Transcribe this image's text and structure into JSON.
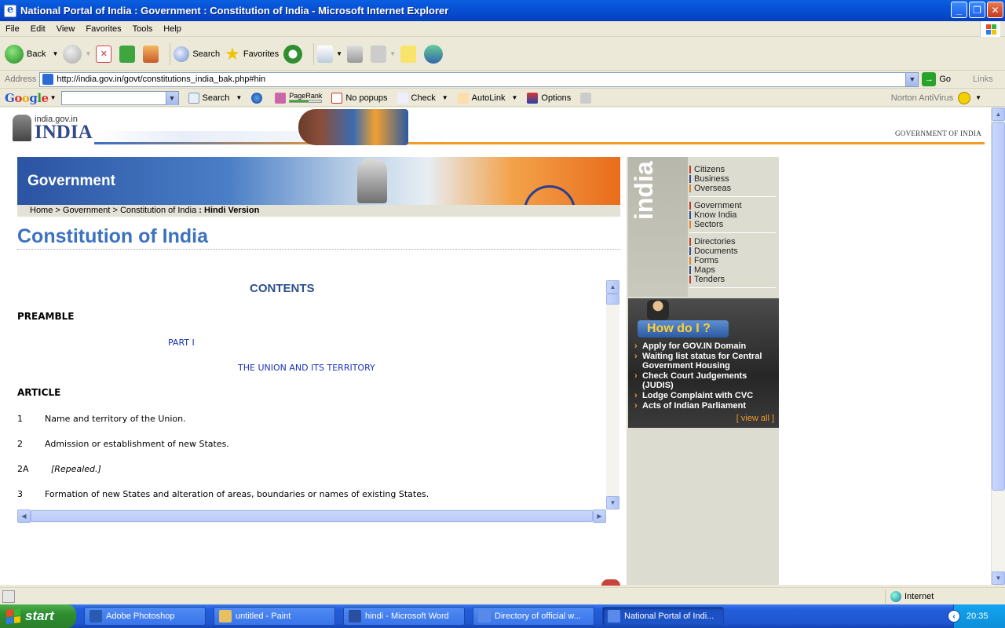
{
  "window": {
    "title": "National Portal of India : Government : Constitution of India - Microsoft Internet Explorer"
  },
  "menu": [
    "File",
    "Edit",
    "View",
    "Favorites",
    "Tools",
    "Help"
  ],
  "toolbar": {
    "back": "Back",
    "search": "Search",
    "favorites": "Favorites"
  },
  "address": {
    "label": "Address",
    "url": "http://india.gov.in/govt/constitutions_india_bak.php#hin",
    "go": "Go",
    "links": "Links"
  },
  "googlebar": {
    "brand": "Google",
    "search": "Search",
    "pagerank": "PageRank",
    "popups": "No popups",
    "check": "Check",
    "autolink": "AutoLink",
    "options": "Options",
    "norton": "Norton AntiVirus"
  },
  "site": {
    "domain": "india.gov.in",
    "logo_word": "INDIA",
    "gov_label": "GOVERNMENT OF INDIA",
    "banner": "Government",
    "breadcrumb": {
      "home": "Home",
      "government": "Government",
      "constitution": "Constitution of India",
      "hindi": "Hindi Version"
    },
    "page_title": "Constitution of India"
  },
  "document": {
    "contents": "CONTENTS",
    "preamble": "PREAMBLE",
    "part": "PART I",
    "part_title": "THE UNION AND ITS TERRITORY",
    "article": "ARTICLE",
    "rows": [
      {
        "num": "1",
        "text": "Name and territory of the Union."
      },
      {
        "num": "2",
        "text": "Admission or establishment of new States."
      },
      {
        "num": "2A",
        "text": "[Repealed.]"
      },
      {
        "num": "3",
        "text": "Formation of new States and alteration of areas, boundaries or names of existing States."
      }
    ]
  },
  "sidebar": {
    "word": "india",
    "groups": [
      [
        {
          "label": "Citizens",
          "color": "#c0392b"
        },
        {
          "label": "Business",
          "color": "#2c4f8f"
        },
        {
          "label": "Overseas",
          "color": "#e67e22"
        }
      ],
      [
        {
          "label": "Government",
          "color": "#c0392b"
        },
        {
          "label": "Know India",
          "color": "#2c4f8f"
        },
        {
          "label": "Sectors",
          "color": "#e67e22"
        }
      ],
      [
        {
          "label": "Directories",
          "color": "#c0392b"
        },
        {
          "label": "Documents",
          "color": "#2c4f8f"
        },
        {
          "label": "Forms",
          "color": "#e67e22"
        },
        {
          "label": "Maps",
          "color": "#2c4f8f"
        },
        {
          "label": "Tenders",
          "color": "#c0392b"
        }
      ]
    ],
    "howdo": {
      "title": "How do I ?",
      "items": [
        "Apply for GOV.IN Domain",
        "Waiting list status for Central Government Housing",
        "Check Court Judgements (JUDIS)",
        "Lodge Complaint with CVC",
        "Acts of Indian Parliament"
      ],
      "view_all": "[ view all ]"
    }
  },
  "status": {
    "zone": "Internet"
  },
  "taskbar": {
    "start": "start",
    "tasks": [
      "Adobe Photoshop",
      "untitled - Paint",
      "hindi - Microsoft Word",
      "Directory of official w...",
      "National Portal of Indi..."
    ],
    "time": "20:35"
  }
}
